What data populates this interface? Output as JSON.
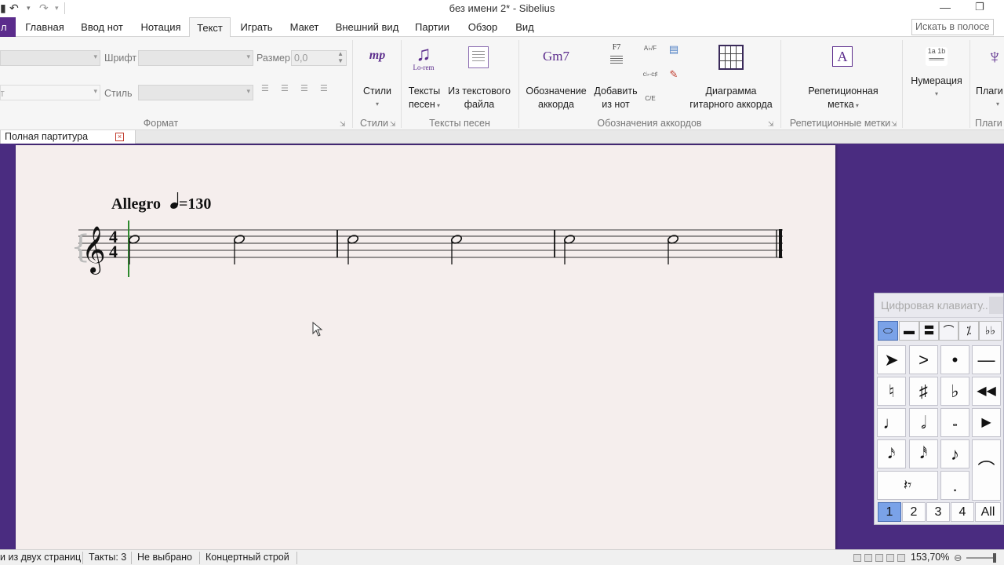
{
  "window": {
    "title": "без имени 2* - Sibelius",
    "undo_icon": "undo-icon",
    "redo_icon": "redo-icon",
    "minimize_icon": "minimize-icon",
    "restore_icon": "restore-icon"
  },
  "tabs": {
    "file": "л",
    "items": [
      "Главная",
      "Ввод нот",
      "Нотация",
      "Текст",
      "Играть",
      "Макет",
      "Внешний вид",
      "Партии",
      "Обзор",
      "Вид"
    ],
    "active": "Текст"
  },
  "search": {
    "placeholder": "Искать в полосе"
  },
  "ribbon": {
    "format": {
      "font_label": "Шрифт",
      "size_label": "Размер",
      "size_value": "0,0",
      "style_label": "Стиль",
      "partial_label": "т",
      "group_label": "Формат"
    },
    "styles": {
      "icon_text": "mp",
      "label": "Стили",
      "group_label": "Стили"
    },
    "lyrics": {
      "icon_text": "Lo-rem",
      "btn1_line1": "Тексты",
      "btn1_line2": "песен",
      "btn2_line1": "Из текстового",
      "btn2_line2": "файла",
      "group_label": "Тексты песен"
    },
    "chords": {
      "icon_text": "Gm7",
      "btn1_line1": "Обозначение",
      "btn1_line2": "аккорда",
      "btn2_icon": "F7",
      "btn2_line1": "Добавить",
      "btn2_line2": "из нот",
      "small_icon1": "A♭/F",
      "small_icon2": "C/E",
      "btn3_line1": "Диаграмма",
      "btn3_line2": "гитарного аккорда",
      "group_label": "Обозначения аккордов"
    },
    "rehearsal": {
      "icon_text": "A",
      "btn_line1": "Репетиционная",
      "btn_line2": "метка",
      "group_label": "Репетиционные метки"
    },
    "numbering": {
      "label": "Нумерация"
    },
    "plugins": {
      "label": "Плаги",
      "group_label": "Плаги"
    }
  },
  "document": {
    "tab_label": "Полная партитура"
  },
  "score": {
    "tempo_word": "Allegro",
    "tempo_value": "=130",
    "time_sig_top": "4",
    "time_sig_bottom": "4"
  },
  "keypad": {
    "title": "Цифровая клавиату...",
    "top_tabs": [
      "o",
      "—",
      "=",
      "⌒",
      "⁒",
      "♭♭"
    ],
    "numbers": [
      "1",
      "2",
      "3",
      "4",
      "All"
    ]
  },
  "status": {
    "pages": "и из двух страниц",
    "bars": "Такты: 3",
    "selection": "Не выбрано",
    "pitch": "Концертный строй",
    "zoom": "153,70%"
  }
}
